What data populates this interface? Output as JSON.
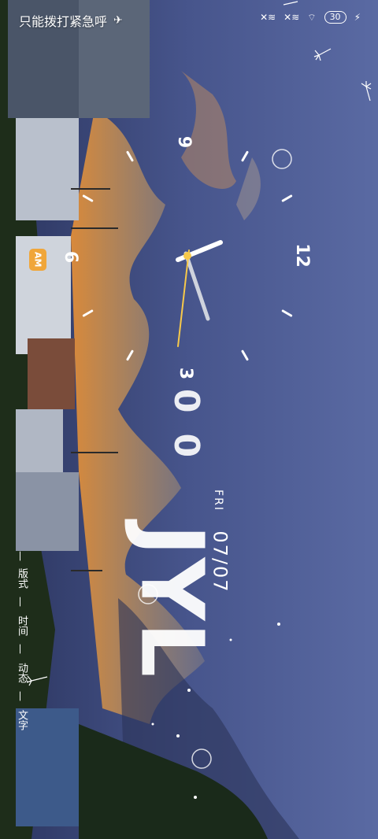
{
  "status_bar": {
    "left_text": "只能拨打紧急呼",
    "battery": "30"
  },
  "clock": {
    "numerals": [
      "12",
      "3",
      "6",
      "9"
    ],
    "am_pm": "AM",
    "hour_angle_deg": 110,
    "minute_angle_deg": 335,
    "second_angle_deg": 258
  },
  "date": {
    "time_digits": "00",
    "day": "FRI",
    "date": "07/07",
    "name": "JYL"
  },
  "side_menu": [
    "版式",
    "时间",
    "动态",
    "文字"
  ],
  "colors": {
    "accent": "#f0a63a",
    "second_hand": "#f7c94a",
    "sky_top": "#5a6aa3",
    "sky_bottom": "#2c3660"
  }
}
